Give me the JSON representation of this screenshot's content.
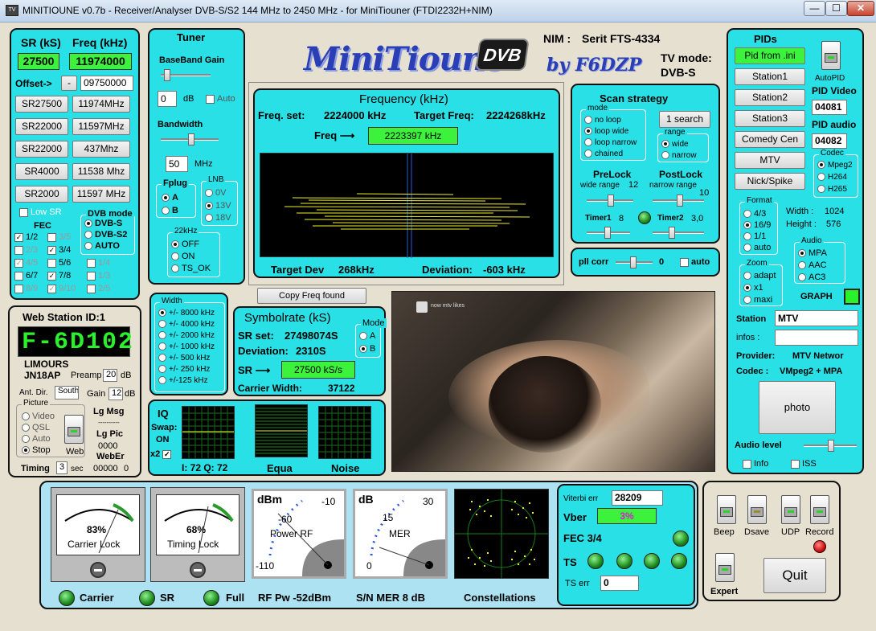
{
  "window": {
    "title": "MINITIOUNE v0.7b - Receiver/Analyser DVB-S/S2 144 MHz to 2450 MHz - for MiniTiouner (FTDI2232H+NIM)",
    "icon": "app-icon",
    "min": "—",
    "max": "☐",
    "close": "✕"
  },
  "left": {
    "sr_label": "SR (kS)",
    "freq_label": "Freq (kHz)",
    "sr_value": "27500",
    "freq_value": "11974000",
    "offset_label": "Offset->",
    "offset_minus": "-",
    "offset_value": "09750000",
    "presets": [
      {
        "sr": "SR27500",
        "freq": "11974MHz"
      },
      {
        "sr": "SR22000",
        "freq": "11597MHz"
      },
      {
        "sr": "SR22000",
        "freq": "437Mhz"
      },
      {
        "sr": "SR4000",
        "freq": "11538 Mhz"
      },
      {
        "sr": "SR2000",
        "freq": "11597 MHz"
      }
    ],
    "low_sr": "Low SR",
    "fec_label": "FEC",
    "fec": [
      "1/2",
      "3/5",
      "2/3",
      "3/4",
      "4/5",
      "5/6",
      "6/7",
      "7/8",
      "8/9",
      "9/10"
    ],
    "fec_extra": [
      "1/4",
      "1/3",
      "2/5"
    ],
    "dvb_mode_label": "DVB mode",
    "dvb_modes": [
      "DVB-S",
      "DVB-S2",
      "AUTO"
    ]
  },
  "web": {
    "title": "Web Station ID:1",
    "callsign": "F-6D102",
    "town": "LIMOURS",
    "locator": "JN18AP",
    "preamp_label": "Preamp",
    "preamp": "20",
    "db": "dB",
    "ant_label": "Ant. Dir.",
    "ant": "South",
    "gain_label": "Gain",
    "gain": "12",
    "picture_label": "Picture",
    "picture_opts": [
      "Video",
      "QSL",
      "Auto",
      "Stop"
    ],
    "web_label": "Web",
    "lgmsg": "Lg Msg",
    "dashes": "----------",
    "lgpic": "Lg Pic",
    "lgpic_val": "0000",
    "weber": "WebEr",
    "weber_val": "00000",
    "weber_n": "0",
    "timing_label": "Timing",
    "timing": "3",
    "sec": "sec"
  },
  "tuner": {
    "title": "Tuner",
    "bb_gain": "BaseBand Gain",
    "bb_val": "0",
    "db": "dB",
    "auto": "Auto",
    "bandwidth": "Bandwidth",
    "bw_val": "50",
    "mhz": "MHz",
    "fplug": "Fplug",
    "fplug_opts": [
      "A",
      "B"
    ],
    "lnb": "LNB",
    "lnb_opts": [
      "0V",
      "13V",
      "18V"
    ],
    "khz22": "22kHz",
    "khz22_opts": [
      "OFF",
      "ON",
      "TS_OK"
    ]
  },
  "width": {
    "label": "Width",
    "opts": [
      "+/- 8000 kHz",
      "+/- 4000 kHz",
      "+/- 2000 kHz",
      "+/- 1000 kHz",
      "+/- 500 kHz",
      "+/- 250 kHz",
      "+/-125 kHz"
    ]
  },
  "logo": {
    "text": "MiniTioune",
    "badge": "DVB",
    "by": "by F6DZP"
  },
  "nim": {
    "label": "NIM :",
    "value": "Serit FTS-4334",
    "tv_mode_label": "TV mode:",
    "tv_mode": "DVB-S"
  },
  "frequency": {
    "title": "Frequency (kHz)",
    "freq_set_label": "Freq. set:",
    "freq_set": "2224000 kHz",
    "target_label": "Target Freq:",
    "target": "2224268kHz",
    "freq_arrow": "Freq ⟶",
    "freq": "2223397 kHz",
    "target_dev_label": "Target Dev",
    "target_dev": "268kHz",
    "deviation_label": "Deviation:",
    "deviation": "-603 kHz"
  },
  "copy_freq": "Copy Freq found",
  "symbolrate": {
    "title": "Symbolrate (kS)",
    "sr_set_label": "SR set:",
    "sr_set": "27498074S",
    "deviation_label": "Deviation:",
    "deviation": "2310S",
    "sr_arrow": "SR ⟶",
    "sr": "27500 kS/s",
    "carrier_label": "Carrier Width:",
    "carrier": "37122",
    "mode_label": "Mode",
    "mode_opts": [
      "A",
      "B"
    ]
  },
  "iq": {
    "label": "IQ",
    "swap_label": "Swap:",
    "swap": "ON",
    "x2": "x2",
    "iq_readout": "I: 72 Q: 72",
    "equa": "Equa",
    "noise": "Noise"
  },
  "scan": {
    "title": "Scan strategy",
    "mode_label": "mode",
    "modes": [
      "no loop",
      "loop wide",
      "loop narrow",
      "chained"
    ],
    "search_btn": "1 search",
    "range_label": "range",
    "ranges": [
      "wide",
      "narrow"
    ],
    "prelock": "PreLock",
    "postlock": "PostLock",
    "wide_range": "wide range",
    "wide_val": "12",
    "narrow_range": "narrow range",
    "narrow_val": "10",
    "timer1": "Timer1",
    "timer1_val": "8",
    "timer2": "Timer2",
    "timer2_val": "3,0"
  },
  "pll": {
    "label": "pll corr",
    "value": "0",
    "auto": "auto"
  },
  "pids": {
    "title": "PIDs",
    "from_ini": "Pid from .ini",
    "stations": [
      "Station1",
      "Station2",
      "Station3",
      "Comedy Cen",
      "MTV",
      "Nick/Spike"
    ],
    "autopid": "AutoPID",
    "pid_video_label": "PID Video",
    "pid_video": "04081",
    "pid_audio_label": "PID audio",
    "pid_audio": "04082",
    "codec_label": "Codec",
    "codecs": [
      "Mpeg2",
      "H264",
      "H265"
    ],
    "format_label": "Format",
    "formats": [
      "4/3",
      "16/9",
      "1/1",
      "auto"
    ],
    "width_label": "Width :",
    "width": "1024",
    "height_label": "Height :",
    "height": "576",
    "audio_label": "Audio",
    "audios": [
      "MPA",
      "AAC",
      "AC3"
    ],
    "zoom_label": "Zoom",
    "zooms": [
      "adapt",
      "x1",
      "maxi"
    ],
    "graph": "GRAPH",
    "station_label": "Station",
    "station": "MTV",
    "infos_label": "infos :",
    "infos": "",
    "provider_label": "Provider:",
    "provider": "MTV Networ",
    "codec2_label": "Codec :",
    "codec2": "VMpeg2 + MPA",
    "photo": "photo",
    "audio_level": "Audio level",
    "info": "Info",
    "iss": "ISS"
  },
  "video": {
    "overlay": "now mtv likes"
  },
  "bottom": {
    "carrier_pct": "83%",
    "carrier_lock": "Carrier Lock",
    "timing_pct": "68%",
    "timing_lock": "Timing Lock",
    "dbm": "dBm",
    "p_m10": "-10",
    "p_m60": "-60",
    "p_m110": "-110",
    "power_rf": "Power RF",
    "db": "dB",
    "m30": "30",
    "m15": "15",
    "m0": "0",
    "mer": "MER",
    "carrier": "Carrier",
    "sr": "SR",
    "full": "Full",
    "rfpw": "RF Pw -52dBm",
    "snmer": "S/N MER  8 dB",
    "constellations": "Constellations",
    "viterbi_label": "Viterbi err",
    "viterbi": "28209",
    "vber_label": "Vber",
    "vber": "3%",
    "fec": "FEC 3/4",
    "ts": "TS",
    "ts_err_label": "TS err",
    "ts_err": "0"
  },
  "controls": {
    "beep": "Beep",
    "dsave": "Dsave",
    "udp": "UDP",
    "record": "Record",
    "expert": "Expert",
    "quit": "Quit"
  }
}
